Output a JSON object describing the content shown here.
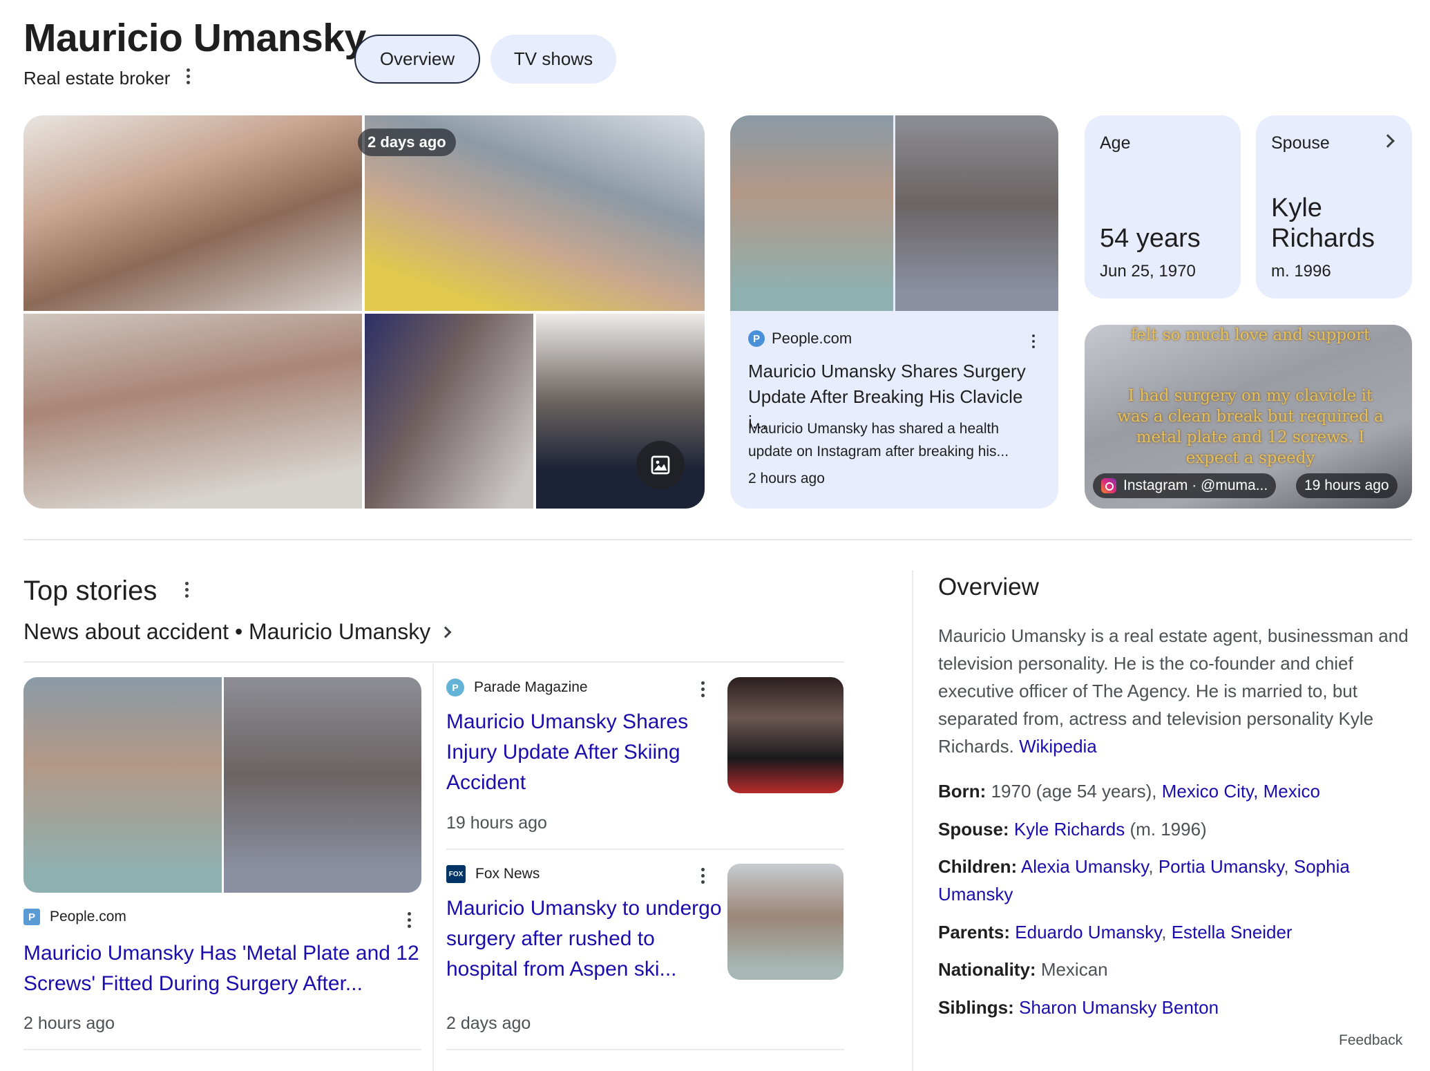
{
  "header": {
    "title": "Mauricio Umansky",
    "subtitle": "Real estate broker",
    "tabs": [
      {
        "label": "Overview",
        "selected": true
      },
      {
        "label": "TV shows",
        "selected": false
      }
    ]
  },
  "images": {
    "badge": "2 days ago"
  },
  "news_card": {
    "source": "People.com",
    "title": "Mauricio Umansky Shares Surgery Update After Breaking His Clavicle i...",
    "snippet": "Mauricio Umansky has shared a health update on Instagram after breaking his...",
    "time": "2 hours ago"
  },
  "facts": {
    "age": {
      "label": "Age",
      "value": "54 years",
      "detail": "Jun 25, 1970"
    },
    "spouse": {
      "label": "Spouse",
      "value_line1": "Kyle",
      "value_line2": "Richards",
      "detail": "m. 1996"
    }
  },
  "instagram": {
    "caption_top": "felt so much love and support",
    "caption": "I had surgery on my clavicle it was a clean break but required a metal plate and 12 screws. I expect a speedy",
    "source": "Instagram · @muma...",
    "time": "19 hours ago"
  },
  "top_stories": {
    "title": "Top stories",
    "subheading": "News about accident • Mauricio Umansky",
    "stories": [
      {
        "source": "People.com",
        "title": "Mauricio Umansky Has 'Metal Plate and 12 Screws' Fitted During Surgery After...",
        "time": "2 hours ago"
      },
      {
        "source": "Parade Magazine",
        "title": "Mauricio Umansky Shares Injury Update After Skiing Accident",
        "time": "19 hours ago"
      },
      {
        "source": "Fox News",
        "title": "Mauricio Umansky to undergo surgery after rushed to hospital from Aspen ski...",
        "time": "2 days ago"
      }
    ]
  },
  "overview": {
    "title": "Overview",
    "description": "Mauricio Umansky is a real estate agent, businessman and television personality. He is the co-founder and chief executive officer of The Agency. He is married to, but separated from, actress and television personality Kyle Richards.",
    "wiki_link": "Wikipedia",
    "born_label": "Born:",
    "born_text": "1970 (age 54 years),",
    "born_link": "Mexico City, Mexico",
    "spouse_label": "Spouse:",
    "spouse_link": "Kyle Richards",
    "spouse_text": "(m. 1996)",
    "children_label": "Children:",
    "children_links": [
      "Alexia Umansky",
      "Portia Umansky",
      "Sophia Umansky"
    ],
    "parents_label": "Parents:",
    "parents_links": [
      "Eduardo Umansky",
      "Estella Sneider"
    ],
    "nationality_label": "Nationality:",
    "nationality_text": "Mexican",
    "siblings_label": "Siblings:",
    "siblings_link": "Sharon Umansky Benton",
    "feedback": "Feedback"
  },
  "colors": {
    "link": "#1a0dab",
    "card_bg": "#e7edfc",
    "chip_border": "#1f2a44"
  }
}
